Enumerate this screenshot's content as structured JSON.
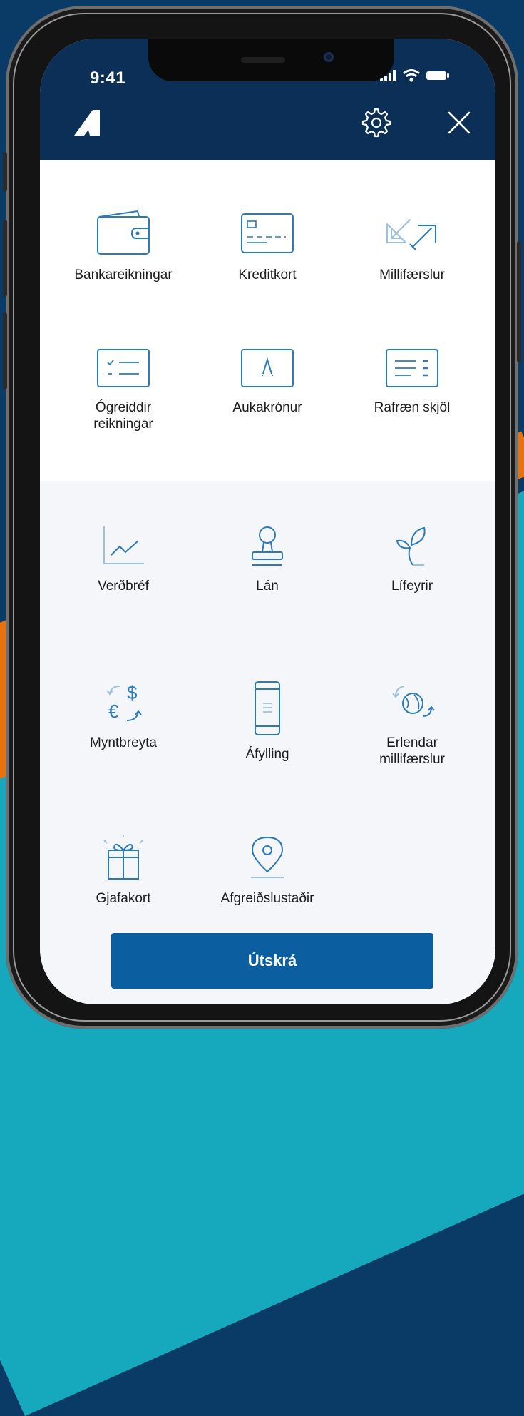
{
  "status": {
    "time": "9:41"
  },
  "colors": {
    "header": "#0c2f57",
    "accent": "#0b5ea0",
    "icon_stroke": "#2d7ab8"
  },
  "menu_primary": [
    {
      "icon": "wallet-icon",
      "label": "Bankareikningar"
    },
    {
      "icon": "credit-card-icon",
      "label": "Kreditkort"
    },
    {
      "icon": "transfer-arrows-icon",
      "label": "Millifærslur"
    },
    {
      "icon": "bill-list-icon",
      "label": "Ógreiddir\nreikningar"
    },
    {
      "icon": "bonus-card-icon",
      "label": "Aukakrónur"
    },
    {
      "icon": "document-icon",
      "label": "Rafræn skjöl"
    }
  ],
  "menu_secondary": [
    {
      "icon": "line-chart-icon",
      "label": "Verðbréf"
    },
    {
      "icon": "stamp-icon",
      "label": "Lán"
    },
    {
      "icon": "sprout-icon",
      "label": "Lífeyrir"
    },
    {
      "icon": "currency-exchange-icon",
      "label": "Myntbreyta"
    },
    {
      "icon": "phone-topup-icon",
      "label": "Áfylling"
    },
    {
      "icon": "globe-transfer-icon",
      "label": "Erlendar\nmillifærslur"
    },
    {
      "icon": "gift-icon",
      "label": "Gjafakort"
    },
    {
      "icon": "location-pin-icon",
      "label": "Afgreiðslustaðir"
    }
  ],
  "logout_label": "Útskrá"
}
